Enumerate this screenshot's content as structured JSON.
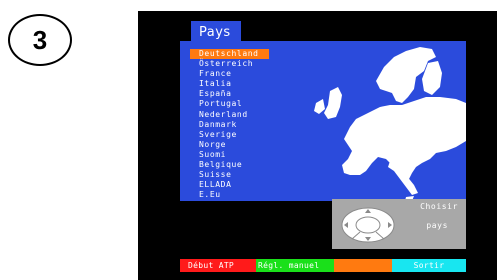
{
  "step": {
    "number": "3"
  },
  "screen": {
    "title": "Pays",
    "countries": [
      "Deutschland",
      "Österreich",
      "France",
      "Italia",
      "España",
      "Portugal",
      "Nederland",
      "Danmark",
      "Sverige",
      "Norge",
      "Suomi",
      "Belgique",
      "Suisse",
      "ELLADA",
      "E.Eu"
    ],
    "selected_index": 0,
    "hint": {
      "line1": "Choisir",
      "line2": "pays"
    },
    "buttons": {
      "red": "Début ATP",
      "green": "Régl. manuel",
      "yellow": "",
      "cyan": "Sortir"
    }
  },
  "colors": {
    "panel_blue": "#2b4bdc",
    "highlight_orange": "#ff7a10",
    "red": "#ff1a1a",
    "green": "#1ae01a",
    "cyan": "#18e6f0",
    "hint_gray": "#a8a8a8"
  }
}
